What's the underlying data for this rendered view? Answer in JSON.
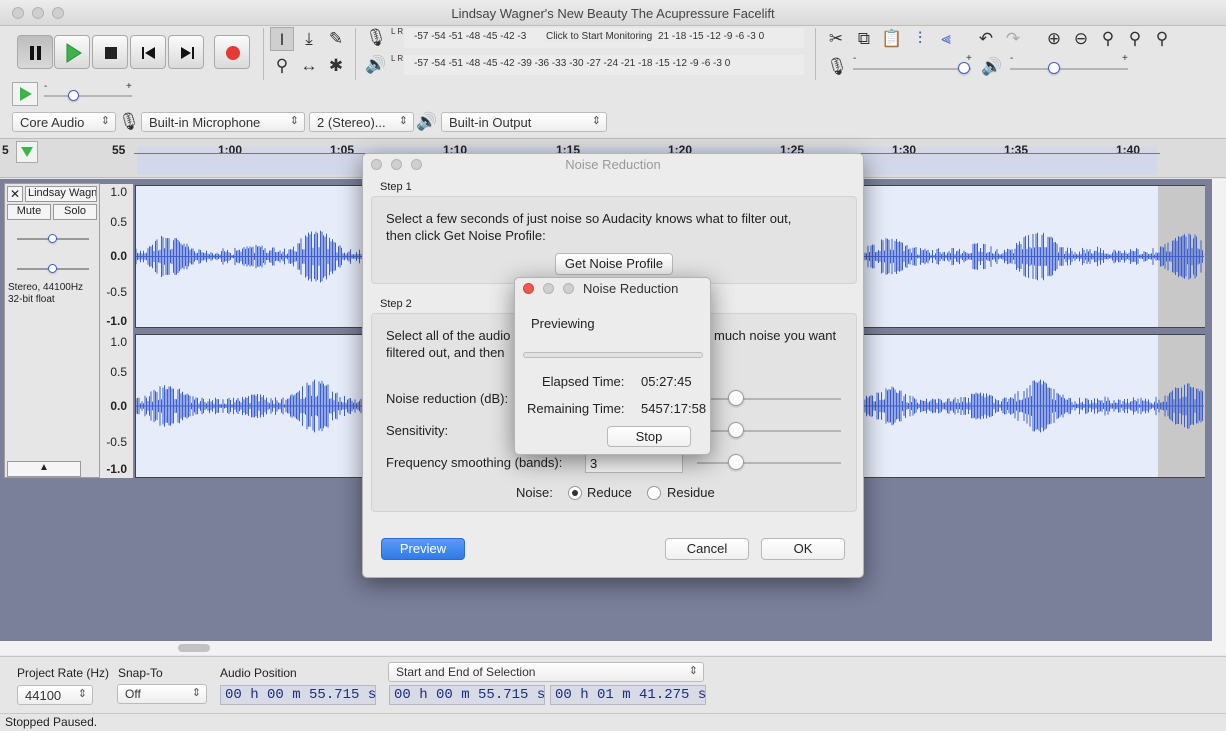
{
  "window": {
    "title": "Lindsay Wagner's New Beauty The Acupressure Facelift"
  },
  "meters": {
    "record_scale": "-57 -54 -51 -48 -45 -42 -3",
    "monitor_label": "Click to Start Monitoring",
    "record_scale_tail": "21 -18 -15 -12 -9 -6 -3 0",
    "play_scale": "-57 -54 -51 -48 -45 -42 -39 -36 -33 -30 -27 -24 -21 -18 -15 -12 -9 -6 -3 0",
    "lr_top": "L R",
    "lr_bottom": "L R"
  },
  "devices": {
    "host": "Core Audio",
    "input": "Built-in Microphone",
    "channels": "2 (Stereo)...",
    "output": "Built-in Output"
  },
  "ruler": {
    "ticks": [
      "5",
      "55",
      "1:00",
      "1:05",
      "1:10",
      "1:15",
      "1:20",
      "1:25",
      "1:30",
      "1:35",
      "1:40"
    ]
  },
  "track": {
    "name": "Lindsay Wagn",
    "mute": "Mute",
    "solo": "Solo",
    "info_line1": "Stereo, 44100Hz",
    "info_line2": "32-bit float",
    "scale": [
      "1.0",
      "0.5",
      "0.0",
      "-0.5",
      "-1.0"
    ]
  },
  "noise_dialog": {
    "title": "Noise Reduction",
    "step1_label": "Step 1",
    "step1_text_line1": "Select a few seconds of just noise so Audacity knows what to filter out,",
    "step1_text_line2": "then click Get Noise Profile:",
    "get_profile_button": "Get Noise Profile",
    "step2_label": "Step 2",
    "step2_text_line1_a": "Select all of the audio",
    "step2_text_line1_b": "much noise you want",
    "step2_text_line2": "filtered out, and then",
    "noise_reduction_label": "Noise reduction (dB):",
    "sensitivity_label": "Sensitivity:",
    "freq_smoothing_label": "Frequency smoothing (bands):",
    "freq_smoothing_value": "3",
    "noise_label": "Noise:",
    "reduce_label": "Reduce",
    "residue_label": "Residue",
    "preview_button": "Preview",
    "cancel_button": "Cancel",
    "ok_button": "OK"
  },
  "progress_dialog": {
    "title": "Noise Reduction",
    "status": "Previewing",
    "elapsed_label": "Elapsed Time:",
    "elapsed_value": "05:27:45",
    "remaining_label": "Remaining Time:",
    "remaining_value": "5457:17:58",
    "stop_button": "Stop",
    "progress_fraction": 0
  },
  "bottom": {
    "project_rate_label": "Project Rate (Hz)",
    "project_rate_value": "44100",
    "snap_to_label": "Snap-To",
    "snap_to_value": "Off",
    "audio_position_label": "Audio Position",
    "audio_position_value": "00 h 00 m 55.715 s",
    "selection_mode": "Start and End of Selection",
    "selection_start": "00 h 00 m 55.715 s",
    "selection_end": "00 h 01 m 41.275 s"
  },
  "status_bar": {
    "text": "Stopped Paused."
  },
  "colors": {
    "waveform": "#3d5fcf",
    "record": "#e33b33",
    "play": "#3bb54a",
    "track_bg": "#e6ecf9",
    "area_bg": "#7a7f9a"
  }
}
